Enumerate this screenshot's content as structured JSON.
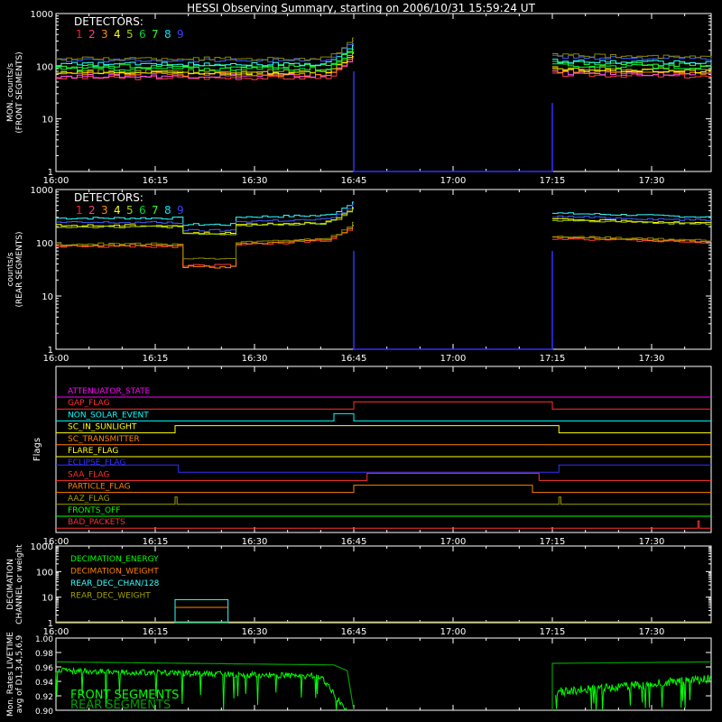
{
  "title": "HESSI Observing Summary, starting on 2006/10/31 15:59:24 UT",
  "x_ticks": [
    "16:00",
    "16:15",
    "16:30",
    "16:45",
    "17:00",
    "17:15",
    "17:30"
  ],
  "colors": {
    "background": "#000000",
    "axes": "#ffffff",
    "det": [
      "#ff2020",
      "#ff3b8a",
      "#ff8a00",
      "#ffff00",
      "#a0d000",
      "#00d040",
      "#2aff2a",
      "#00e0ff",
      "#4040ff"
    ],
    "front_series": [
      "#ff3b3b",
      "#ff55ff",
      "#ff8a00",
      "#ffff00",
      "#b0b000",
      "#00ff40",
      "#2aff2a",
      "#30ffff",
      "#4060ff",
      "#888800"
    ],
    "rear_series": [
      "#ff3b3b",
      "#ff8a00",
      "#ffff00",
      "#a0d000",
      "#30ffff",
      "#4060ff",
      "#888800"
    ]
  },
  "chart_data": [
    {
      "type": "line",
      "panel": "front_counts",
      "ylabel": "MON. counts/s\n(FRONT SEGMENTS)",
      "yscale": "log",
      "ylim": [
        1,
        1000
      ],
      "yticks": [
        "1",
        "10",
        "100",
        "1000"
      ],
      "legend_title": "DETECTORS:",
      "legend_entries": [
        "1",
        "2",
        "3",
        "4",
        "5",
        "6",
        "7",
        "8",
        "9"
      ],
      "xrange": [
        "16:00",
        "17:39"
      ],
      "data_gap": [
        "16:45",
        "17:15"
      ],
      "series_levels": [
        60,
        65,
        70,
        75,
        80,
        90,
        100,
        110,
        130,
        140
      ]
    },
    {
      "type": "line",
      "panel": "rear_counts",
      "ylabel": "counts/s\n(REAR SEGMENTS)",
      "yscale": "log",
      "ylim": [
        1,
        1000
      ],
      "yticks": [
        "1",
        "10",
        "100",
        "1000"
      ],
      "legend_title": "DETECTORS:",
      "legend_entries": [
        "1",
        "2",
        "3",
        "4",
        "5",
        "6",
        "7",
        "8",
        "9"
      ],
      "data_gap": [
        "16:45",
        "17:15"
      ]
    },
    {
      "type": "flags",
      "panel": "flags",
      "ylabel": "Flags",
      "flags": [
        {
          "name": "ATTENUATOR_STATE",
          "color": "#ff00ff"
        },
        {
          "name": "GAP_FLAG",
          "color": "#ff3030"
        },
        {
          "name": "NON_SOLAR_EVENT",
          "color": "#00ffff"
        },
        {
          "name": "SC_IN_SUNLIGHT",
          "color": "#ffff00"
        },
        {
          "name": "SC_TRANSMITTER",
          "color": "#ff8000"
        },
        {
          "name": "FLARE_FLAG",
          "color": "#ffff00"
        },
        {
          "name": "ECLIPSE_FLAG",
          "color": "#3030ff"
        },
        {
          "name": "SAA_FLAG",
          "color": "#ff3030"
        },
        {
          "name": "PARTICLE_FLAG",
          "color": "#ff8000"
        },
        {
          "name": "AAZ_FLAG",
          "color": "#a0a000"
        },
        {
          "name": "FRONTS_OFF",
          "color": "#00ff00"
        },
        {
          "name": "BAD_PACKETS",
          "color": "#ff3030"
        }
      ]
    },
    {
      "type": "line",
      "panel": "decimation",
      "ylabel": "DECIMATION\nCHANNEL or weight",
      "yscale": "log",
      "ylim": [
        1,
        1000
      ],
      "yticks": [
        "1",
        "10",
        "100",
        "1000"
      ],
      "legend": [
        {
          "name": "DECIMATION_ENERGY",
          "color": "#00ff00"
        },
        {
          "name": "DECIMATION_WEIGHT",
          "color": "#ff8000"
        },
        {
          "name": "REAR_DEC_CHAN/128",
          "color": "#30ffff"
        },
        {
          "name": "REAR_DEC_WEIGHT",
          "color": "#a0a000"
        }
      ],
      "rect": {
        "start": "16:18",
        "end": "16:26",
        "rear_chan": 8,
        "weight": 4
      }
    },
    {
      "type": "line",
      "panel": "livetime",
      "ylabel": "Mon. Rates LIVETIME\navg of D1,3,4,5,6,9",
      "ylim": [
        0.9,
        1.0
      ],
      "yticks": [
        "0.90",
        "0.92",
        "0.94",
        "0.96",
        "0.98",
        "1.00"
      ],
      "legend": [
        {
          "name": "FRONT SEGMENTS",
          "color": "#00ff00"
        },
        {
          "name": "REAR SEGMENTS",
          "color": "#00a000"
        }
      ]
    }
  ]
}
